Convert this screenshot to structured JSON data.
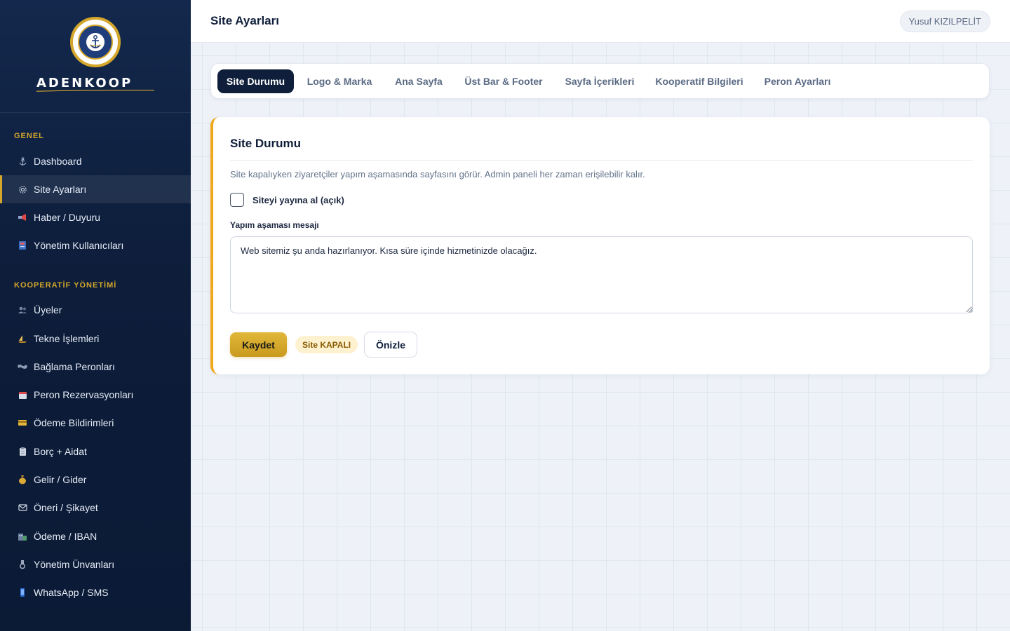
{
  "brand": {
    "name": "ADENKOOP"
  },
  "sidebar": {
    "sections": [
      {
        "title": "GENEL"
      },
      {
        "title": "KOOPERATİF YÖNETİMİ"
      }
    ],
    "general_items": [
      {
        "label": "Dashboard",
        "icon": "anchor-icon"
      },
      {
        "label": "Site Ayarları",
        "icon": "gear-icon",
        "active": true
      },
      {
        "label": "Haber / Duyuru",
        "icon": "megaphone-icon"
      },
      {
        "label": "Yönetim Kullanıcıları",
        "icon": "users-book-icon"
      }
    ],
    "coop_items": [
      {
        "label": "Üyeler",
        "icon": "members-icon"
      },
      {
        "label": "Tekne İşlemleri",
        "icon": "boat-icon"
      },
      {
        "label": "Bağlama Peronları",
        "icon": "map-icon"
      },
      {
        "label": "Peron Rezervasyonları",
        "icon": "calendar-icon"
      },
      {
        "label": "Ödeme Bildirimleri",
        "icon": "credit-card-icon"
      },
      {
        "label": "Borç + Aidat",
        "icon": "clipboard-icon"
      },
      {
        "label": "Gelir / Gider",
        "icon": "money-bag-icon"
      },
      {
        "label": "Öneri / Şikayet",
        "icon": "envelope-icon"
      },
      {
        "label": "Ödeme / IBAN",
        "icon": "bank-icon"
      },
      {
        "label": "Yönetim Ünvanları",
        "icon": "medal-icon"
      },
      {
        "label": "WhatsApp / SMS",
        "icon": "phone-icon"
      }
    ]
  },
  "header": {
    "title": "Site Ayarları",
    "user": "Yusuf KIZILPELİT"
  },
  "tabs": [
    {
      "label": "Site Durumu",
      "active": true
    },
    {
      "label": "Logo & Marka"
    },
    {
      "label": "Ana Sayfa"
    },
    {
      "label": "Üst Bar & Footer"
    },
    {
      "label": "Sayfa İçerikleri"
    },
    {
      "label": "Kooperatif Bilgileri"
    },
    {
      "label": "Peron Ayarları"
    }
  ],
  "card": {
    "title": "Site Durumu",
    "description": "Site kapalıyken ziyaretçiler yapım aşamasında sayfasını görür. Admin paneli her zaman erişilebilir kalır.",
    "checkbox_label": "Siteyi yayına al (açık)",
    "checkbox_checked": false,
    "message_label": "Yapım aşaması mesajı",
    "message_value": "Web sitemiz şu anda hazırlanıyor. Kısa süre içinde hizmetinizde olacağız.",
    "save_label": "Kaydet",
    "status_label": "Site KAPALI",
    "preview_label": "Önizle"
  },
  "colors": {
    "sidebar_bg": "#0d1d3a",
    "accent_gold": "#d4a72c",
    "card_accent": "#f0a81c",
    "status_bg": "#fdf1cf",
    "status_text": "#8a5a00"
  }
}
